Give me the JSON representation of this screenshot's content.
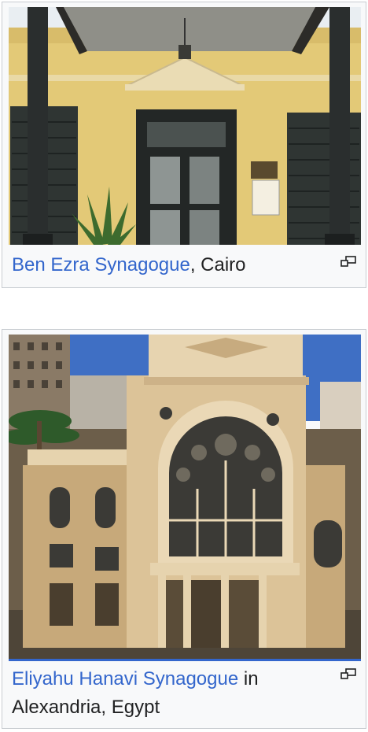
{
  "figures": [
    {
      "link_text": "Ben Ezra Synagogue",
      "suffix_text": ", Cairo",
      "enlarge_icon": "magnify-clip-icon"
    },
    {
      "link_text": "Eliyahu Hanavi Synagogue",
      "suffix_text": " in Alexandria, Egypt",
      "enlarge_icon": "magnify-clip-icon"
    }
  ],
  "colors": {
    "link": "#3366cc",
    "text": "#202122",
    "frame_bg": "#f8f9fa",
    "frame_border": "#c8ccd1"
  }
}
